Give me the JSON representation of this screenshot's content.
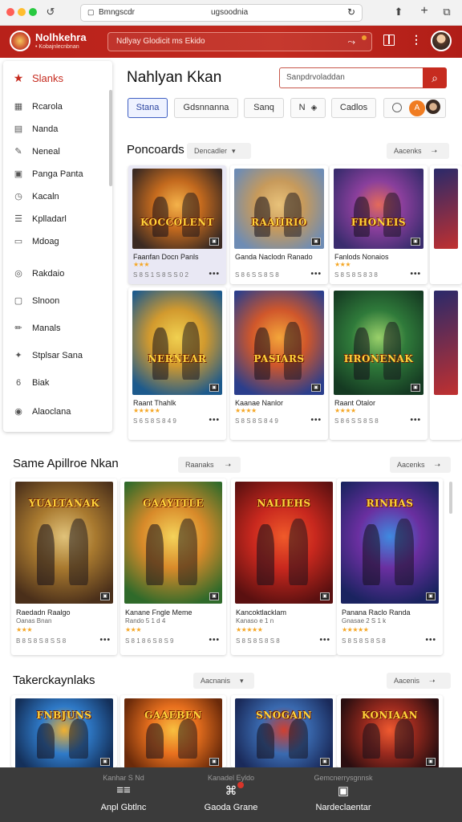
{
  "browser": {
    "tab_left": "Bmngscdr",
    "url": "ugsoodnia",
    "colors": {
      "red": "#ff5f57",
      "yellow": "#ffbd2e",
      "green": "#28c940"
    },
    "icons": [
      "back-icon",
      "lock-icon",
      "reload-icon",
      "share-icon",
      "new-tab-icon",
      "tabs-icon"
    ]
  },
  "app": {
    "brand": "Nolhkehra",
    "brand_sub": "• Kobajnlecnbnan",
    "search_text": "Ndlyay Glodicit ms Ekido",
    "accent": "#c62b1f"
  },
  "sidebar": {
    "items": [
      {
        "label": "Slanks",
        "icon": "star-icon",
        "active": true
      },
      {
        "label": "Rcarola",
        "icon": "grid-icon"
      },
      {
        "label": "Nanda",
        "icon": "calendar-icon"
      },
      {
        "label": "Neneal",
        "icon": "pen-icon"
      },
      {
        "label": "Panga Panta",
        "icon": "image-icon"
      },
      {
        "label": "Kacaln",
        "icon": "clock-icon"
      },
      {
        "label": "Kplladarl",
        "icon": "list-icon"
      },
      {
        "label": "Mdoag",
        "icon": "monitor-icon"
      },
      {
        "label": "Rakdaio",
        "icon": "chat-icon"
      },
      {
        "label": "Slnoon",
        "icon": "tv-icon"
      },
      {
        "label": "Manals",
        "icon": "pencil-icon"
      },
      {
        "label": "Stplsar Sana",
        "icon": "puzzle-icon"
      },
      {
        "label": "Biak",
        "icon": "six-icon"
      },
      {
        "label": "Alaoclana",
        "icon": "compass-icon"
      }
    ]
  },
  "main": {
    "title": "Nahlyan Kkan",
    "search_placeholder": "Sanpdrvoladdan",
    "chips": [
      "Stana",
      "Gdsnnanna",
      "Sanq",
      "N",
      "Cadlos"
    ],
    "chip_badge": "A"
  },
  "section1": {
    "title": "Poncoards",
    "dropdown": "Dencadler",
    "action": "Aacenks",
    "cards": [
      {
        "art_title": "KOCCOLENT",
        "title": "Faanfan Docn Panls",
        "rating": 3,
        "meta": "S 8 S 1 S 8 S S 0 2",
        "selected": true
      },
      {
        "art_title": "RAAIIRIO",
        "title": "Ganda Naclodn Ranado",
        "rating": 0,
        "meta": "S 8 6 S S 8 S 8",
        "selected": false
      },
      {
        "art_title": "FHONEIS",
        "title": "Fanlods Nonaios",
        "rating": 3,
        "meta": "S 8 S 8 S 8 3 8",
        "selected": false
      },
      {
        "art_title": "NERNEAR",
        "title": "Raant Thahlk",
        "rating": 5,
        "meta": "S 6 S 8 S 8 4 9",
        "selected": false
      },
      {
        "art_title": "PASIARS",
        "title": "Kaanae Nanlor",
        "rating": 4,
        "meta": "S 8 S 8 S 8 4 9",
        "selected": false
      },
      {
        "art_title": "HRONENAK",
        "title": "Raant Otalor",
        "rating": 4,
        "meta": "S 8 6 S S 8 S 8",
        "selected": false
      }
    ]
  },
  "section2": {
    "title": "Same Apillroe Nkan",
    "dropdown": "Raanaks",
    "action": "Aacenks",
    "cards": [
      {
        "art_title": "YUALTANAK",
        "title": "Raedadn Raalgo",
        "sub": "Oanas Bnan",
        "rating": 3,
        "meta": "B 8 S 8 S 8 S S 8"
      },
      {
        "art_title": "GAAYTTLE",
        "title": "Kanane Fngle Meme",
        "sub": "Rando 5 1 d 4",
        "rating": 3,
        "meta": "S 8 1 8 6 S 8 S 9"
      },
      {
        "art_title": "NALIEHS",
        "title": "Kancoktlacklam",
        "sub": "Kanaso e 1 n",
        "rating": 5,
        "meta": "S 8 S 8 S 8 S 8"
      },
      {
        "art_title": "RINHAS",
        "title": "Panana Raclo Randa",
        "sub": "Gnasae 2 S 1 k",
        "rating": 5,
        "meta": "S 8 S 8 S 8 S 8"
      }
    ]
  },
  "section3": {
    "title": "Takerckaynlaks",
    "dropdown": "Aacnanis",
    "action": "Aacenis",
    "cards": [
      {
        "art_title": "FNBJUNS"
      },
      {
        "art_title": "GAAEBEN"
      },
      {
        "art_title": "SNOGAIN"
      },
      {
        "art_title": "KONIAAN"
      }
    ]
  },
  "bottom_nav": {
    "items": [
      {
        "label": "Anpl Gbtlnc",
        "icon": "game-icon",
        "overlay": "Kanhar S Nd"
      },
      {
        "label": "Gaoda Grane",
        "icon": "controller-icon",
        "overlay": "Kanadel Eyldo"
      },
      {
        "label": "Nardeclaentar",
        "icon": "store-icon",
        "overlay": "Gemcnerrysgnnsk"
      }
    ]
  }
}
